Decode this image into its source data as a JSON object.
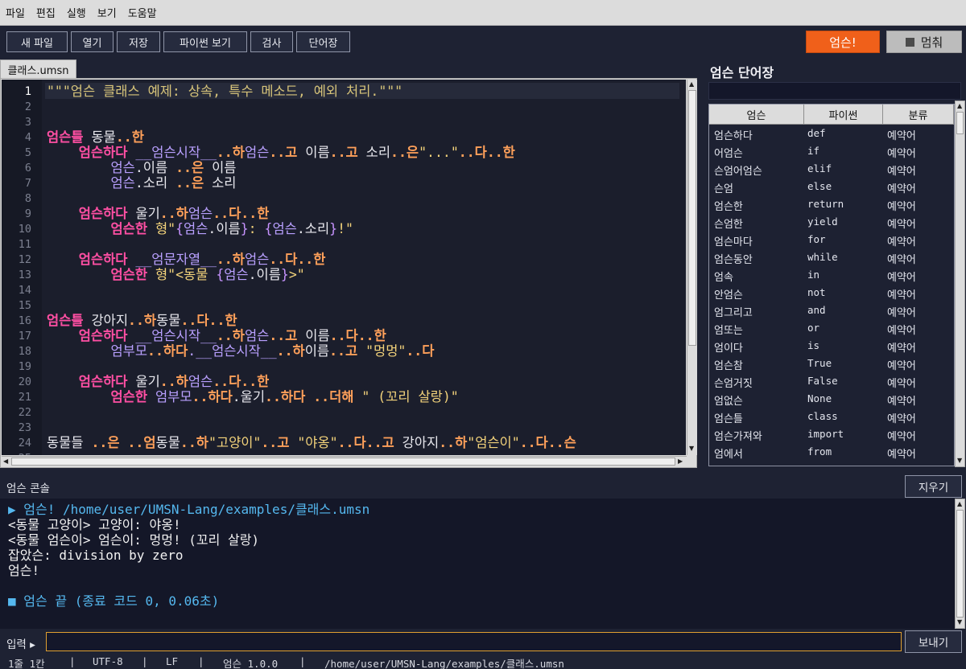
{
  "menu": [
    "파일",
    "편집",
    "실행",
    "보기",
    "도움말"
  ],
  "toolbar": {
    "buttons": [
      "새 파일",
      "열기",
      "저장",
      "파이썬 보기",
      "검사",
      "단어장"
    ],
    "run": "엄슨!",
    "stop": "멈춰"
  },
  "editor": {
    "tab": "클래스.umsn",
    "current_line": 1,
    "lines": [
      [
        [
          "cm",
          "\"\"\"엄슨 클래스 예제: 상속, 특수 메소드, 예외 처리.\"\"\""
        ]
      ],
      [],
      [],
      [
        [
          "kw",
          "엄슨틀"
        ],
        [
          "id",
          " 동물"
        ],
        [
          "op",
          "..한"
        ]
      ],
      [
        [
          "id",
          "    "
        ],
        [
          "kw",
          "엄슨하다"
        ],
        [
          "sf",
          " __엄슨시작__"
        ],
        [
          "op",
          "..하"
        ],
        [
          "sf",
          "엄슨"
        ],
        [
          "op",
          "..고"
        ],
        [
          "id",
          " 이름"
        ],
        [
          "op",
          "..고"
        ],
        [
          "id",
          " 소리"
        ],
        [
          "op",
          "..은"
        ],
        [
          "st",
          "\"...\""
        ],
        [
          "op",
          "..다..한"
        ]
      ],
      [
        [
          "id",
          "        "
        ],
        [
          "sf",
          "엄슨"
        ],
        [
          "id",
          ".이름 "
        ],
        [
          "op",
          "..은"
        ],
        [
          "id",
          " 이름"
        ]
      ],
      [
        [
          "id",
          "        "
        ],
        [
          "sf",
          "엄슨"
        ],
        [
          "id",
          ".소리 "
        ],
        [
          "op",
          "..은"
        ],
        [
          "id",
          " 소리"
        ]
      ],
      [],
      [
        [
          "id",
          "    "
        ],
        [
          "kw",
          "엄슨하다"
        ],
        [
          "id",
          " 울기"
        ],
        [
          "op",
          "..하"
        ],
        [
          "sf",
          "엄슨"
        ],
        [
          "op",
          "..다..한"
        ]
      ],
      [
        [
          "id",
          "        "
        ],
        [
          "kw",
          "엄슨한"
        ],
        [
          "st",
          " 형\""
        ],
        [
          "br",
          "{"
        ],
        [
          "sf",
          "엄슨"
        ],
        [
          "id",
          ".이름"
        ],
        [
          "br",
          "}"
        ],
        [
          "st",
          ": "
        ],
        [
          "br",
          "{"
        ],
        [
          "sf",
          "엄슨"
        ],
        [
          "id",
          ".소리"
        ],
        [
          "br",
          "}"
        ],
        [
          "st",
          "!\""
        ]
      ],
      [],
      [
        [
          "id",
          "    "
        ],
        [
          "kw",
          "엄슨하다"
        ],
        [
          "sf",
          " __엄문자열__"
        ],
        [
          "op",
          "..하"
        ],
        [
          "sf",
          "엄슨"
        ],
        [
          "op",
          "..다..한"
        ]
      ],
      [
        [
          "id",
          "        "
        ],
        [
          "kw",
          "엄슨한"
        ],
        [
          "st",
          " 형\"<동물 "
        ],
        [
          "br",
          "{"
        ],
        [
          "sf",
          "엄슨"
        ],
        [
          "id",
          ".이름"
        ],
        [
          "br",
          "}"
        ],
        [
          "st",
          ">\""
        ]
      ],
      [],
      [],
      [
        [
          "kw",
          "엄슨틀"
        ],
        [
          "id",
          " 강아지"
        ],
        [
          "op",
          "..하"
        ],
        [
          "id",
          "동물"
        ],
        [
          "op",
          "..다..한"
        ]
      ],
      [
        [
          "id",
          "    "
        ],
        [
          "kw",
          "엄슨하다"
        ],
        [
          "sf",
          " __엄슨시작__"
        ],
        [
          "op",
          "..하"
        ],
        [
          "sf",
          "엄슨"
        ],
        [
          "op",
          "..고"
        ],
        [
          "id",
          " 이름"
        ],
        [
          "op",
          "..다..한"
        ]
      ],
      [
        [
          "id",
          "        "
        ],
        [
          "sf",
          "엄부모"
        ],
        [
          "op",
          "..하다"
        ],
        [
          "sf",
          ".__엄슨시작__"
        ],
        [
          "op",
          "..하"
        ],
        [
          "id",
          "이름"
        ],
        [
          "op",
          "..고"
        ],
        [
          "st",
          " \"멍멍\""
        ],
        [
          "op",
          "..다"
        ]
      ],
      [],
      [
        [
          "id",
          "    "
        ],
        [
          "kw",
          "엄슨하다"
        ],
        [
          "id",
          " 울기"
        ],
        [
          "op",
          "..하"
        ],
        [
          "sf",
          "엄슨"
        ],
        [
          "op",
          "..다..한"
        ]
      ],
      [
        [
          "id",
          "        "
        ],
        [
          "kw",
          "엄슨한"
        ],
        [
          "sf",
          " 엄부모"
        ],
        [
          "op",
          "..하다"
        ],
        [
          "id",
          ".울기"
        ],
        [
          "op",
          "..하다 ..더해"
        ],
        [
          "st",
          " \" (꼬리 살랑)\""
        ]
      ],
      [],
      [],
      [
        [
          "id",
          "동물들 "
        ],
        [
          "op",
          "..은 ..엄"
        ],
        [
          "id",
          "동물"
        ],
        [
          "op",
          "..하"
        ],
        [
          "st",
          "\"고양이\""
        ],
        [
          "op",
          "..고"
        ],
        [
          "st",
          " \"야옹\""
        ],
        [
          "op",
          "..다..고"
        ],
        [
          "id",
          " 강아지"
        ],
        [
          "op",
          "..하"
        ],
        [
          "st",
          "\"엄슨이\""
        ],
        [
          "op",
          "..다..슨"
        ]
      ]
    ]
  },
  "vocab": {
    "title": "엄슨 단어장",
    "columns": [
      "엄슨",
      "파이썬",
      "분류"
    ],
    "rows": [
      [
        "엄슨하다",
        "def",
        "예약어"
      ],
      [
        "어엄슨",
        "if",
        "예약어"
      ],
      [
        "슨엄어엄슨",
        "elif",
        "예약어"
      ],
      [
        "슨엄",
        "else",
        "예약어"
      ],
      [
        "엄슨한",
        "return",
        "예약어"
      ],
      [
        "슨엄한",
        "yield",
        "예약어"
      ],
      [
        "엄슨마다",
        "for",
        "예약어"
      ],
      [
        "엄슨동안",
        "while",
        "예약어"
      ],
      [
        "엄속",
        "in",
        "예약어"
      ],
      [
        "안엄슨",
        "not",
        "예약어"
      ],
      [
        "엄그리고",
        "and",
        "예약어"
      ],
      [
        "엄또는",
        "or",
        "예약어"
      ],
      [
        "엄이다",
        "is",
        "예약어"
      ],
      [
        "엄슨참",
        "True",
        "예약어"
      ],
      [
        "슨엄거짓",
        "False",
        "예약어"
      ],
      [
        "엄없슨",
        "None",
        "예약어"
      ],
      [
        "엄슨틀",
        "class",
        "예약어"
      ],
      [
        "엄슨가져와",
        "import",
        "예약어"
      ],
      [
        "엄에서",
        "from",
        "예약어"
      ]
    ]
  },
  "console": {
    "title": "엄슨 콘솔",
    "clear": "지우기",
    "lines": [
      {
        "type": "run",
        "text": "▶ 엄슨! /home/user/UMSN-Lang/examples/클래스.umsn"
      },
      {
        "type": "out",
        "text": "<동물 고양이> 고양이: 야옹!"
      },
      {
        "type": "out",
        "text": "<동물 엄슨이> 엄슨이: 멍멍! (꼬리 살랑)"
      },
      {
        "type": "out",
        "text": "잡았슨: division by zero"
      },
      {
        "type": "out",
        "text": "엄슨!"
      },
      {
        "type": "blank",
        "text": ""
      },
      {
        "type": "end",
        "text": "■ 엄슨 끝 (종료 코드 0, 0.06초)"
      }
    ]
  },
  "input": {
    "label": "입력 ▸",
    "value": "",
    "send": "보내기"
  },
  "status": {
    "position": "1줄 1칸",
    "encoding": "UTF-8",
    "eol": "LF",
    "version": "엄슨 1.0.0",
    "path": "/home/user/UMSN-Lang/examples/클래스.umsn",
    "sep": "|"
  }
}
